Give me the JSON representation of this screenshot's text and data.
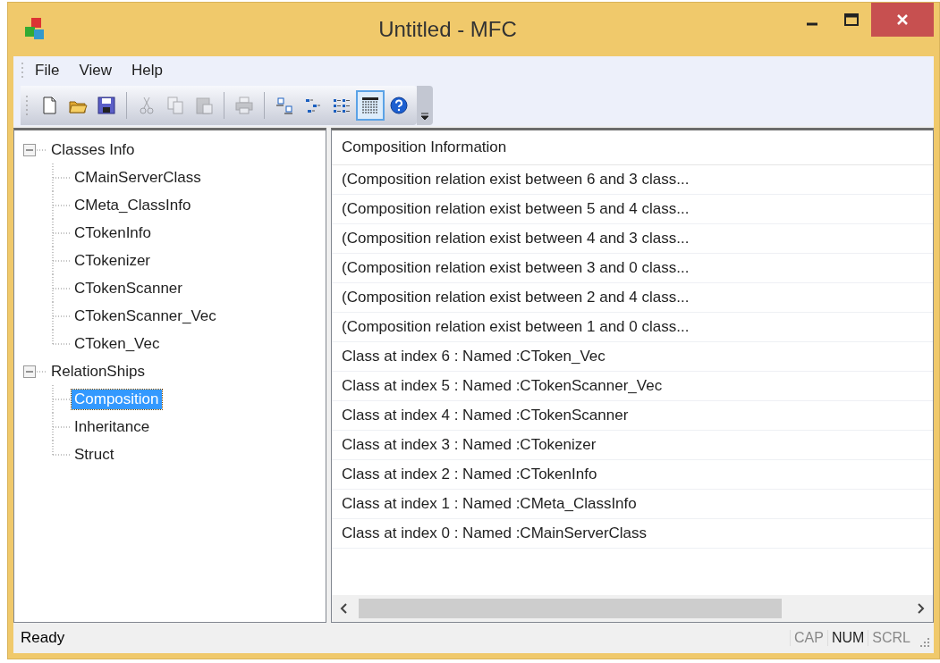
{
  "window": {
    "title": "Untitled - MFC"
  },
  "menu": [
    "File",
    "View",
    "Help"
  ],
  "toolbar": [
    {
      "buttons": [
        {
          "disabled": false,
          "selected": false
        },
        {
          "disabled": false,
          "selected": false
        },
        {
          "disabled": false,
          "selected": false
        }
      ]
    },
    {
      "buttons": [
        {
          "disabled": true,
          "selected": false
        },
        {
          "disabled": true,
          "selected": false
        },
        {
          "disabled": true,
          "selected": false
        }
      ]
    },
    {
      "buttons": [
        {
          "disabled": true,
          "selected": false
        }
      ]
    },
    {
      "buttons": [
        {
          "disabled": false,
          "selected": false
        },
        {
          "disabled": false,
          "selected": false
        },
        {
          "disabled": false,
          "selected": false
        },
        {
          "disabled": false,
          "selected": true
        },
        {
          "disabled": false,
          "selected": false
        }
      ]
    }
  ],
  "tree": [
    {
      "label": "Classes Info",
      "expanded": true,
      "selected": false,
      "children": [
        {
          "label": "CMainServerClass",
          "selected": false
        },
        {
          "label": "CMeta_ClassInfo",
          "selected": false
        },
        {
          "label": "CTokenInfo",
          "selected": false
        },
        {
          "label": "CTokenizer",
          "selected": false
        },
        {
          "label": "CTokenScanner",
          "selected": false
        },
        {
          "label": "CTokenScanner_Vec",
          "selected": false
        },
        {
          "label": "CToken_Vec",
          "selected": false
        }
      ]
    },
    {
      "label": "RelationShips",
      "expanded": true,
      "selected": false,
      "children": [
        {
          "label": "Composition",
          "selected": true
        },
        {
          "label": "Inheritance",
          "selected": false
        },
        {
          "label": "Struct",
          "selected": false
        }
      ]
    }
  ],
  "list": {
    "columns": [
      "Composition Information"
    ],
    "rows": [
      "(Composition relation exist between 6 and 3 class...",
      "(Composition relation exist between 5 and 4 class...",
      "(Composition relation exist between 4 and 3 class...",
      "(Composition relation exist between 3 and 0 class...",
      "(Composition relation exist between 2 and 4 class...",
      "(Composition relation exist between 1 and 0 class...",
      "Class at index 6 : Named :CToken_Vec",
      "Class at index 5 : Named :CTokenScanner_Vec",
      "Class at index 4 : Named :CTokenScanner",
      "Class at index 3 : Named :CTokenizer",
      "Class at index 2 : Named :CTokenInfo",
      "Class at index 1 : Named :CMeta_ClassInfo",
      "Class at index 0 : Named :CMainServerClass"
    ]
  },
  "status_bar": {
    "text": "Ready",
    "indicators": [
      {
        "label": "CAP",
        "on": false
      },
      {
        "label": "NUM",
        "on": true
      },
      {
        "label": "SCRL",
        "on": false
      }
    ]
  }
}
